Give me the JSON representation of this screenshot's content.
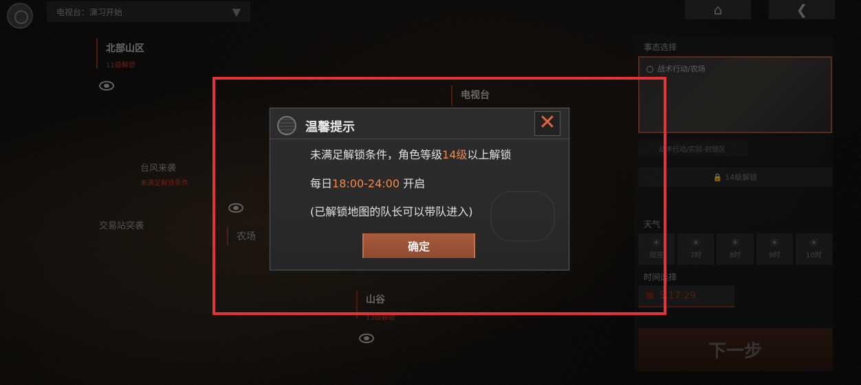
{
  "topbar": {
    "channel_text": "电视台：演习开始",
    "home_icon": "home-icon",
    "back_icon": "back-icon"
  },
  "map": {
    "regions": [
      {
        "name": "北部山区",
        "lock_note": "11级解锁"
      },
      {
        "name": "电视台"
      },
      {
        "name": "台风来袭",
        "lock_note": "未满足解锁条件"
      },
      {
        "name": "交易站突袭"
      },
      {
        "name": "农场"
      },
      {
        "name": "山谷",
        "lock_note": "13级解锁"
      }
    ]
  },
  "side_panel": {
    "scenario_title": "事态选择",
    "scenario_selected": "战术行动/农场",
    "scenario_other": "战术行动/实验-封锁区",
    "unlock_note": "14级解锁",
    "weather_title": "天气",
    "weather_slots": [
      "现在",
      "7时",
      "8时",
      "9时",
      "10时"
    ],
    "time_title": "时间选择",
    "time_value": "5:17:29",
    "next_button": "下一步"
  },
  "dialog": {
    "title": "温馨提示",
    "line1_prefix": "未满足解锁条件，角色等级",
    "line1_level": "14级",
    "line1_suffix": "以上解锁",
    "line2_prefix": "每日",
    "line2_time": "18:00-24:00",
    "line2_suffix": " 开启",
    "line3": "(已解锁地图的队长可以带队进入)",
    "confirm_button": "确定",
    "close_symbol": "✕"
  },
  "colors": {
    "highlight_border": "#e5333a",
    "accent_orange": "#f28a48",
    "button_brown": "#a85a3c"
  }
}
